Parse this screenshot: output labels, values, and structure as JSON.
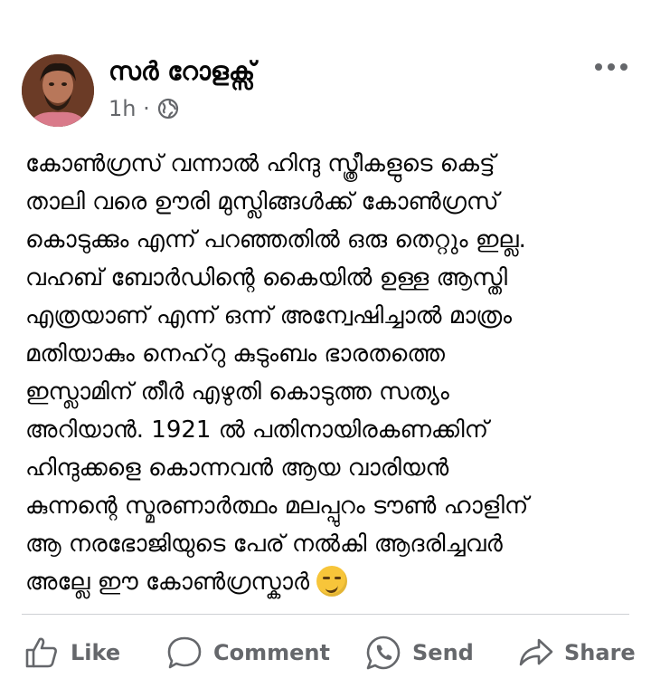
{
  "post": {
    "author": "സർ റോളക്സ്",
    "time": "1h ·",
    "audience_icon": "globe-icon",
    "lines": [
      "കോൺഗ്രസ് വന്നാൽ ഹിന്ദു സ്ത്രീകളുടെ കെട്ട്",
      "താലി വരെ ഊരി മുസ്ലിങ്ങൾക്ക് കോൺഗ്രസ്",
      "കൊടുക്കും എന്ന് പറഞ്ഞതിൽ ഒരു തെറ്റും ഇല്ല.",
      "വഹബ് ബോർഡിന്റെ കൈയിൽ ഉള്ള ആസ്തി",
      "എത്രയാണ് എന്ന് ഒന്ന് അന്വേഷിച്ചാൽ മാത്രം",
      "മതിയാകും നെഹ്‌റു കുടുംബം ഭാരതത്തെ",
      "ഇസ്ലാമിന് തീർ എഴുതി കൊടുത്ത സത്യം",
      "അറിയാൻ. 1921 ൽ പതിനായിരകണക്കിന്",
      "ഹിന്ദുക്കളെ കൊന്നവൻ ആയ വാരിയൻ",
      "കുന്നന്റെ സ്മരണാർത്ഥം മലപ്പുറം ടൗൺ ഹാളിന്",
      "ആ നരഭോജിയുടെ പേര് നൽകി ആദരിച്ചവർ",
      "അല്ലേ ഈ കോൺഗ്രസ്കാർ"
    ],
    "trailing_emoji": "smirking-face-emoji"
  },
  "actions": {
    "like": "Like",
    "comment": "Comment",
    "send": "Send",
    "share": "Share"
  },
  "colors": {
    "text": "#050505",
    "secondary": "#65676b",
    "divider": "#ced0d4"
  }
}
